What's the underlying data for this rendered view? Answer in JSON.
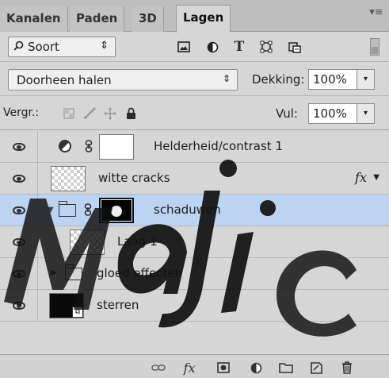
{
  "tabs": [
    {
      "label": "Kanalen"
    },
    {
      "label": "Paden"
    },
    {
      "label": "3D"
    },
    {
      "label": "Lagen"
    }
  ],
  "filter": {
    "kind_label": "Soort",
    "icons": [
      "image-filter-icon",
      "adjustment-filter-icon",
      "type-filter-icon",
      "shape-filter-icon",
      "smart-object-filter-icon"
    ]
  },
  "blend": {
    "mode": "Doorheen halen",
    "opacity_label": "Dekking:",
    "opacity_value": "100%"
  },
  "lock": {
    "label": "Vergr.:",
    "fill_label": "Vul:",
    "fill_value": "100%"
  },
  "layers": [
    {
      "name": "Helderheid/contrast 1"
    },
    {
      "name": "witte cracks",
      "fx": "fx"
    },
    {
      "name": "schaduwen"
    },
    {
      "name": "Laag 1"
    },
    {
      "name": "gloed effecten"
    },
    {
      "name": "sterren"
    }
  ],
  "colors": {
    "selected_row": "#bcd3f1",
    "panel_bg": "#d6d6d6",
    "watermark": "#111111"
  }
}
